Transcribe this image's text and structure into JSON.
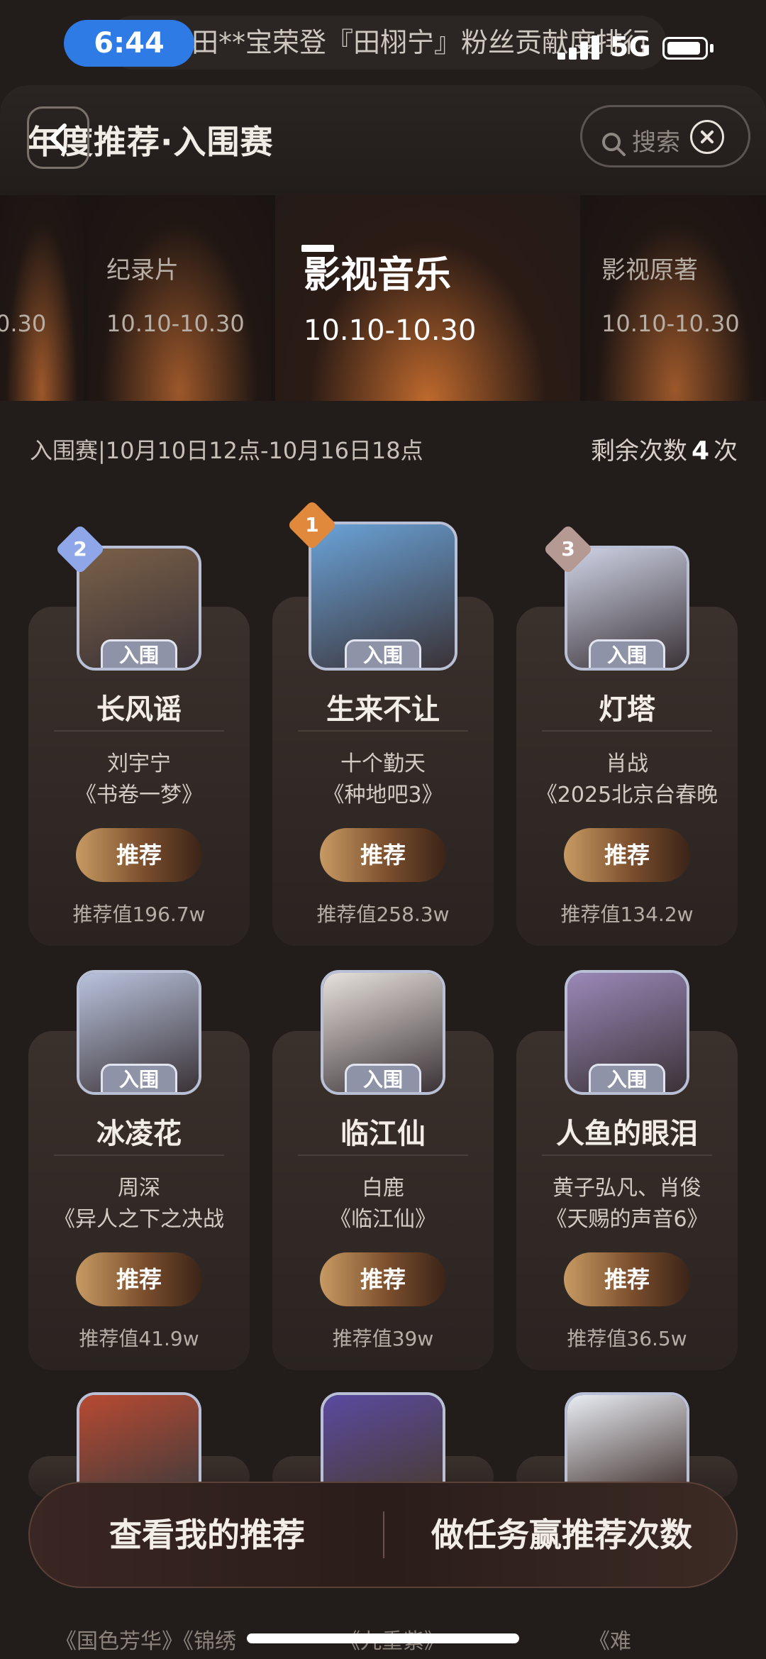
{
  "status_bar": {
    "time": "6:44",
    "ticker": "田**宝荣登『田栩宁』粉丝贡献度排行",
    "network": "5G"
  },
  "header": {
    "title": "年度推荐·入围赛",
    "search_placeholder": "搜索"
  },
  "categories": [
    {
      "name": "",
      "date": "0.30"
    },
    {
      "name": "纪录片",
      "date": "10.10-10.30"
    },
    {
      "name": "影视音乐",
      "date": "10.10-10.30",
      "active": true
    },
    {
      "name": "影视原著",
      "date": "10.10-10.30"
    }
  ],
  "info": {
    "period": "入围赛|10月10日12点-10月16日18点",
    "remaining_label": "剩余次数",
    "remaining_count": "4",
    "remaining_unit": "次"
  },
  "entry_tag": "入围",
  "recommend_label": "推荐",
  "items": [
    {
      "rank": "2",
      "song": "长风谣",
      "artist": "刘宇宁",
      "show": "《书卷一梦》",
      "value": "推荐值196.7w",
      "art": "#7a6048"
    },
    {
      "rank": "1",
      "song": "生来不让",
      "artist": "十个勤天",
      "show": "《种地吧3》",
      "value": "推荐值258.3w",
      "art": "#6aa3d8"
    },
    {
      "rank": "3",
      "song": "灯塔",
      "artist": "肖战",
      "show": "《2025北京台春晚",
      "value": "推荐值134.2w",
      "art": "#cfd3e6"
    },
    {
      "rank": "",
      "song": "冰凌花",
      "artist": "周深",
      "show": "《异人之下之决战",
      "value": "推荐值41.9w",
      "art": "#b9c3dd"
    },
    {
      "rank": "",
      "song": "临江仙",
      "artist": "白鹿",
      "show": "《临江仙》",
      "value": "推荐值39w",
      "art": "#e7e1dc"
    },
    {
      "rank": "",
      "song": "人鱼的眼泪",
      "artist": "黄子弘凡、肖俊",
      "show": "《天赐的声音6》",
      "value": "推荐值36.5w",
      "art": "#9b88b8"
    }
  ],
  "peek_covers": [
    "#b84a32",
    "#5a4aa0",
    "#e9edf3"
  ],
  "bottom_bar": {
    "left": "查看我的推荐",
    "right": "做任务赢推荐次数"
  },
  "peek_text": [
    "《国色芳华》《锦绣",
    "《九重紫》",
    "《难"
  ]
}
